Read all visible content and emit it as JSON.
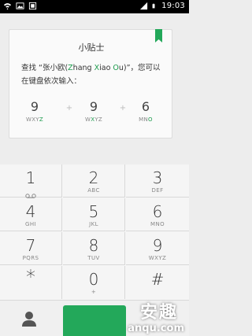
{
  "status_bar": {
    "time": "19:03"
  },
  "tip_card": {
    "title": "小贴士",
    "text_before": "查找 “张小欧(",
    "text_highlight_1": "Z",
    "text_mid_1": "hang ",
    "text_highlight_2": "X",
    "text_mid_2": "iao ",
    "text_highlight_3": "O",
    "text_mid_3": "u)",
    "text_after": "”，您可以在键盘依次输入：",
    "combo": [
      {
        "digit": "9",
        "letters_plain": "WXY",
        "letters_green": "Z"
      },
      {
        "digit": "9",
        "letters_plain_before": "W",
        "letters_green": "X",
        "letters_plain": "YZ"
      },
      {
        "digit": "6",
        "letters_plain": "MN",
        "letters_green": "O"
      }
    ],
    "plus": "+"
  },
  "keypad": [
    {
      "digit": "1",
      "letters": ""
    },
    {
      "digit": "2",
      "letters": "ABC"
    },
    {
      "digit": "3",
      "letters": "DEF"
    },
    {
      "digit": "4",
      "letters": "GHI"
    },
    {
      "digit": "5",
      "letters": "JKL"
    },
    {
      "digit": "6",
      "letters": "MNO"
    },
    {
      "digit": "7",
      "letters": "PQRS"
    },
    {
      "digit": "8",
      "letters": "TUV"
    },
    {
      "digit": "9",
      "letters": "WXYZ"
    },
    {
      "digit": "*",
      "letters": ""
    },
    {
      "digit": "0",
      "letters": "+"
    },
    {
      "digit": "#",
      "letters": ""
    }
  ],
  "watermark": {
    "top": "安趣",
    "bottom": "anqu.com"
  },
  "colors": {
    "accent": "#23a85a",
    "highlight": "#1e9c4e"
  }
}
